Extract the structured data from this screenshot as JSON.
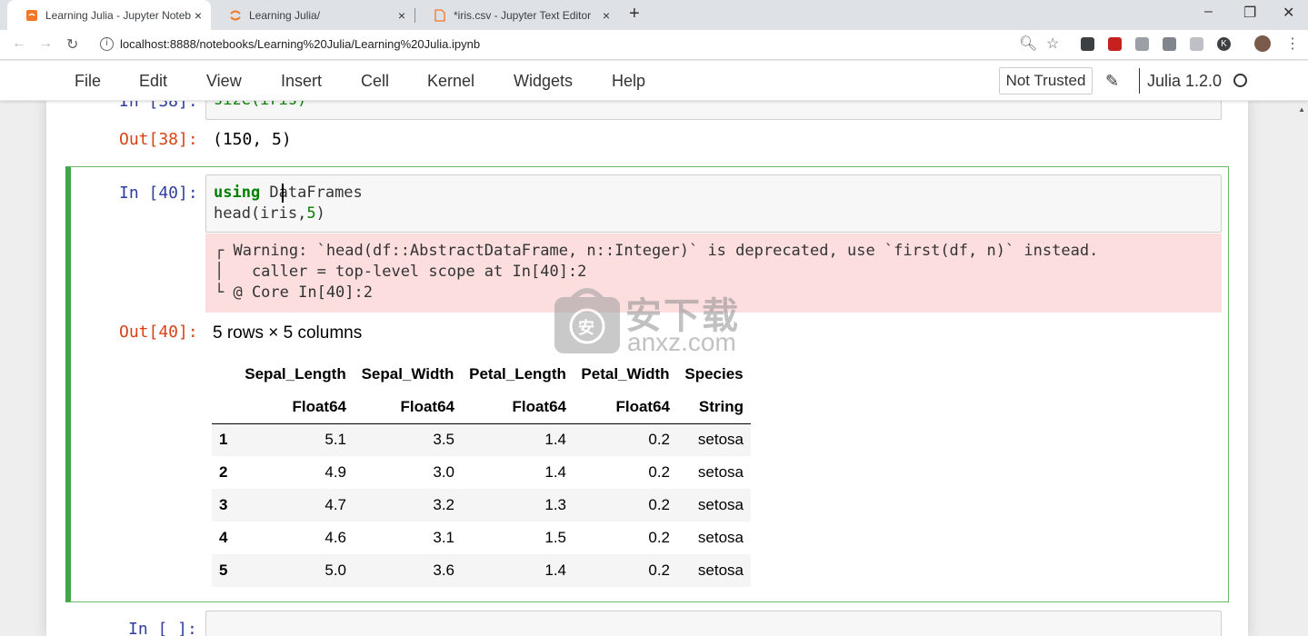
{
  "browser": {
    "tabs": [
      {
        "title": "Learning Julia - Jupyter Notebook",
        "close": "×"
      },
      {
        "title": "Learning Julia/",
        "close": "×"
      },
      {
        "title": "*iris.csv - Jupyter Text Editor",
        "close": "×"
      }
    ],
    "new_tab": "+",
    "window": {
      "minimize": "–",
      "maximize": "❐",
      "close": "✕"
    },
    "url": "localhost:8888/notebooks/Learning%20Julia/Learning%20Julia.ipynb",
    "avatar_letter": "K"
  },
  "menubar": {
    "items": [
      "File",
      "Edit",
      "View",
      "Insert",
      "Cell",
      "Kernel",
      "Widgets",
      "Help"
    ],
    "trusted": "Not Trusted",
    "kernel": "Julia 1.2.0"
  },
  "cells": {
    "c38": {
      "in_prompt": "In [38]:",
      "code": "size(iris)",
      "out_prompt": "Out[38]:",
      "output": "(150, 5)"
    },
    "c40": {
      "in_prompt": "In [40]:",
      "code_line1_kw": "using",
      "code_line1_rest": " DataFrames",
      "code_line2_a": "head(iris,",
      "code_line2_num": "5",
      "code_line2_b": ")",
      "stderr_line1": "┌ Warning: `head(df::AbstractDataFrame, n::Integer)` is deprecated, use `first(df, n)` instead.",
      "stderr_line2": "│   caller = top-level scope at In[40]:2",
      "stderr_line3": "└ @ Core In[40]:2",
      "out_prompt": "Out[40]:",
      "summary": "5 rows × 5 columns"
    },
    "next": {
      "in_prompt": "In [ ]:"
    }
  },
  "dataframe": {
    "columns": [
      "Sepal_Length",
      "Sepal_Width",
      "Petal_Length",
      "Petal_Width",
      "Species"
    ],
    "types": [
      "Float64",
      "Float64",
      "Float64",
      "Float64",
      "String"
    ],
    "rows": [
      [
        "1",
        "5.1",
        "3.5",
        "1.4",
        "0.2",
        "setosa"
      ],
      [
        "2",
        "4.9",
        "3.0",
        "1.4",
        "0.2",
        "setosa"
      ],
      [
        "3",
        "4.7",
        "3.2",
        "1.3",
        "0.2",
        "setosa"
      ],
      [
        "4",
        "4.6",
        "3.1",
        "1.5",
        "0.2",
        "setosa"
      ],
      [
        "5",
        "5.0",
        "3.6",
        "1.4",
        "0.2",
        "setosa"
      ]
    ]
  },
  "watermark": {
    "cn": "安下载",
    "en": "anxz.com",
    "badge": "安"
  }
}
